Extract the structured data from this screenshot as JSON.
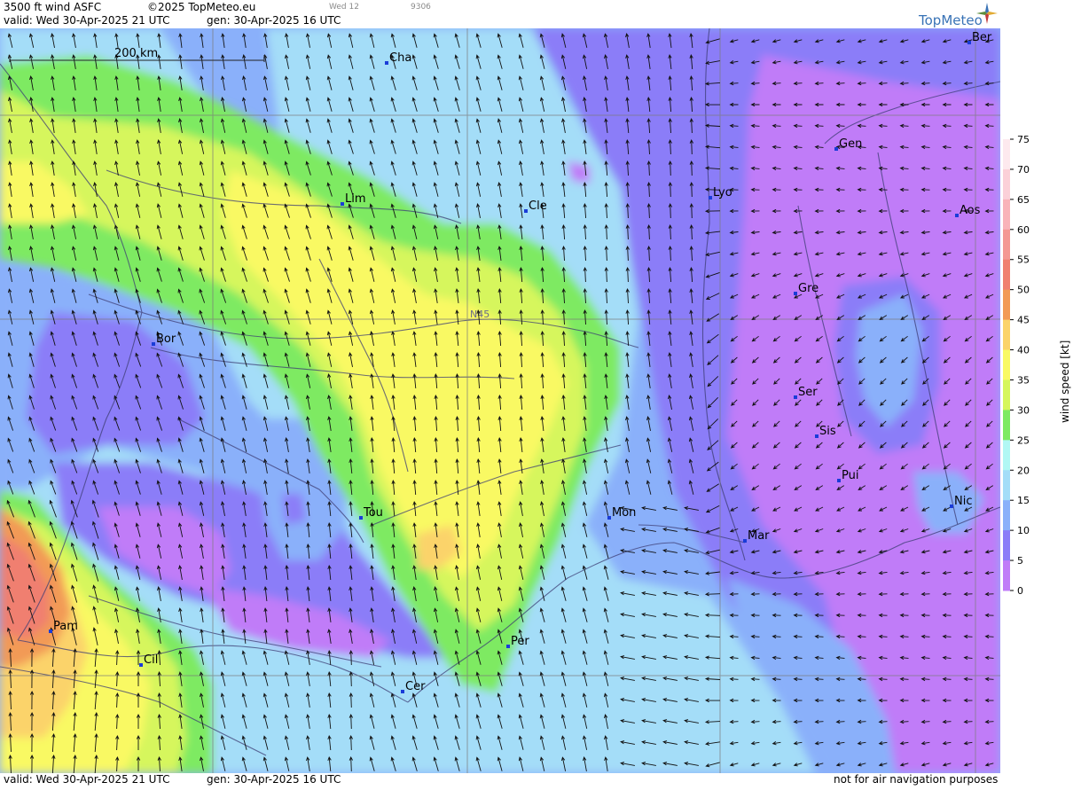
{
  "header": {
    "product": "3500 ft wind ASFC",
    "copyright": "©2025 TopMeteo.eu",
    "valid": "valid:  Wed  30-Apr-2025  21 UTC",
    "generated": "gen: 30-Apr-2025 16 UTC",
    "small_label_1": "Wed 12",
    "small_label_2": "9306"
  },
  "logo": {
    "text": "TopMeteo",
    "icon": "compass-star-icon"
  },
  "scale_bar": {
    "label": "200 km"
  },
  "grid_label": "N45",
  "footer": {
    "valid": "valid:  Wed  30-Apr-2025  21 UTC",
    "generated": "gen: 30-Apr-2025 16 UTC",
    "disclaimer": "not for air navigation purposes"
  },
  "legend": {
    "title": "wind  speed  [kt]",
    "ticks": [
      "75",
      "70",
      "65",
      "60",
      "55",
      "50",
      "45",
      "40",
      "35",
      "30",
      "25",
      "20",
      "15",
      "10",
      "5",
      "0"
    ],
    "colors": [
      "#fde9ee",
      "#fbd0d8",
      "#f9b3b9",
      "#f49894",
      "#f07f70",
      "#f29a57",
      "#fbd36a",
      "#f9f963",
      "#d6f65d",
      "#7eea62",
      "#b1f7f4",
      "#a4ddf8",
      "#8ab0fa",
      "#8b7df8",
      "#c07cf8"
    ]
  },
  "cities": [
    {
      "name": "Cha"
    },
    {
      "name": "Ber"
    },
    {
      "name": "Gen"
    },
    {
      "name": "Lyo"
    },
    {
      "name": "Lim"
    },
    {
      "name": "Cle"
    },
    {
      "name": "Aos"
    },
    {
      "name": "Gre"
    },
    {
      "name": "Bor"
    },
    {
      "name": "Ser"
    },
    {
      "name": "Sis"
    },
    {
      "name": "Pui"
    },
    {
      "name": "Tou"
    },
    {
      "name": "Mon"
    },
    {
      "name": "Mar"
    },
    {
      "name": "Nic"
    },
    {
      "name": "Pam"
    },
    {
      "name": "Cil"
    },
    {
      "name": "Per"
    },
    {
      "name": "Cer"
    }
  ]
}
